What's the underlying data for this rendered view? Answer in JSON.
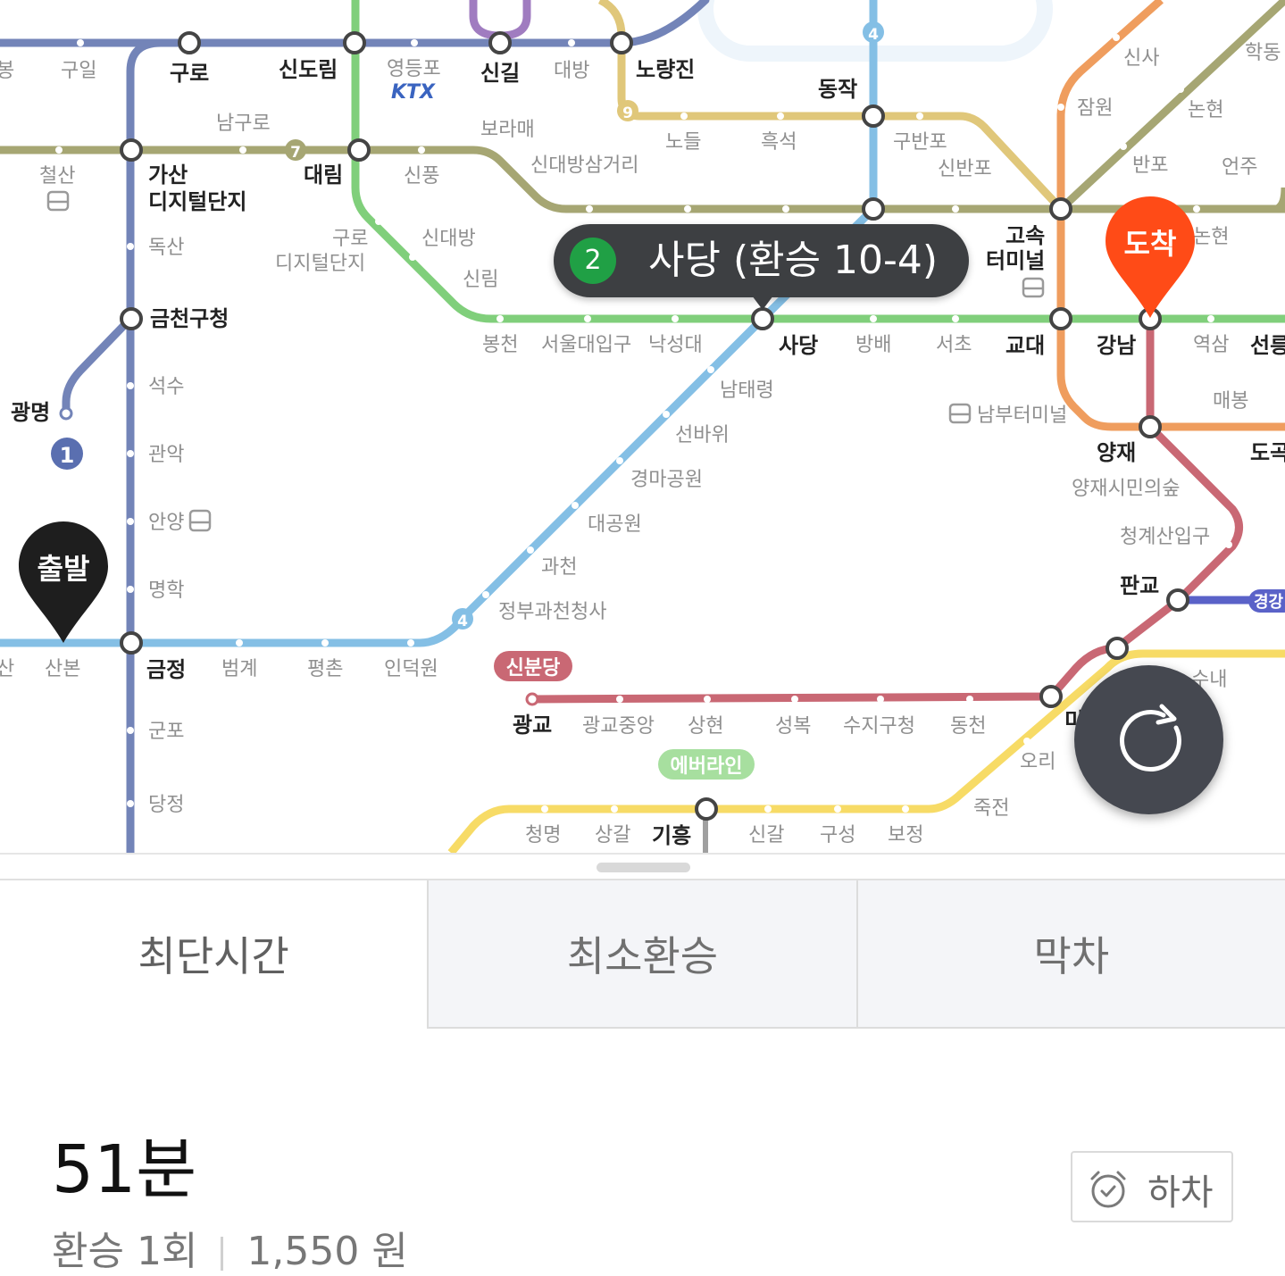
{
  "map": {
    "stations": {
      "guro": "구로",
      "sindorim": "신도림",
      "yeongdeungpo": "영등포",
      "singil": "신길",
      "daebang": "대방",
      "noryangjin": "노량진",
      "guil": "구일",
      "bong": "봉",
      "namguro": "남구로",
      "boramae": "보라매",
      "nodeul": "노들",
      "heukseok": "흑석",
      "dongjak": "동작",
      "gubanpo": "구반포",
      "sinbanpo": "신반포",
      "sinsa": "신사",
      "jamwon": "잠원",
      "nonhyeon": "논현",
      "banpo": "반포",
      "eonju": "언주",
      "hakdong": "학동",
      "cheolsan": "철산",
      "gasan_1": "가산",
      "gasan_2": "디지털단지",
      "daerim": "대림",
      "sinpung": "신풍",
      "sindaebangsamgeori": "신대방삼거리",
      "doksan": "독산",
      "guro_digital_1": "구로",
      "guro_digital_2": "디지털단지",
      "sindaebang": "신대방",
      "sillim": "신림",
      "gosok_1": "고속",
      "gosok_2": "터미널",
      "nonhyeon2": "논현",
      "geumcheon": "금천구청",
      "bongcheon": "봉천",
      "snu": "서울대입구",
      "nakseongdae": "낙성대",
      "sadang": "사당",
      "bangbae": "방배",
      "seocho": "서초",
      "gyodae": "교대",
      "gangnam": "강남",
      "yeoksam": "역삼",
      "seolleung": "선릉",
      "namtaeryeong": "남태령",
      "gwangmyeong": "광명",
      "seoksu": "석수",
      "seonbawi": "선바위",
      "nambu": "남부터미널",
      "maebong": "매봉",
      "gwanak": "관악",
      "gyeongma": "경마공원",
      "yangjae": "양재",
      "yangjaeforest": "양재시민의숲",
      "dogok": "도곡",
      "anyang": "안양",
      "daegongwon": "대공원",
      "cheonggye": "청계산입구",
      "myeonghak": "명학",
      "gwacheon": "과천",
      "pangyo": "판교",
      "gyeonggang": "경강",
      "govt": "정부과천청사",
      "sanbon": "산본",
      "san": "산",
      "geumjeong": "금정",
      "beomgye": "범계",
      "pyeongchon": "평촌",
      "indeogwon": "인덕원",
      "sinbundang": "신분당",
      "suwon_nae": "수내",
      "gwanggyo": "광교",
      "gwanggyojungang": "광교중앙",
      "sanghyeon": "상현",
      "seongbok": "성복",
      "sujigu": "수지구청",
      "dongcheon": "동천",
      "mi": "미",
      "gunpo": "군포",
      "ori": "오리",
      "everline": "에버라인",
      "jukjeon": "죽전",
      "dangjeong": "당정",
      "cheongmyeong": "청명",
      "sanggal": "상갈",
      "giheung": "기흥",
      "singal": "신갈",
      "guseong": "구성",
      "bojeong": "보정",
      "ktx": "KTX"
    },
    "line_badges": {
      "l9": "9",
      "l7": "7",
      "l4_top": "4",
      "l4_bottom": "4",
      "l1": "1"
    },
    "transfer_popup": {
      "line": "2",
      "text": "사당 (환승 10-4)"
    },
    "departure_pin": "출발",
    "arrival_pin": "도착"
  },
  "tabs": [
    {
      "label": "최단시간",
      "active": true
    },
    {
      "label": "최소환승",
      "active": false
    },
    {
      "label": "막차",
      "active": false
    }
  ],
  "result": {
    "time": "51분",
    "transfers": "환승 1회",
    "fare": "1,550 원",
    "alight_button": "하차"
  },
  "colors": {
    "line1": "#7384b8",
    "line2": "#80cf7b",
    "line4": "#84bfe5",
    "line7": "#a6a673",
    "line9": "#e0c77a",
    "shinbundang": "#c96874",
    "suin_bundang": "#f7db66",
    "line8": "#ef9d5e",
    "everline": "#7fc97d",
    "arrival": "#ff4b17"
  }
}
